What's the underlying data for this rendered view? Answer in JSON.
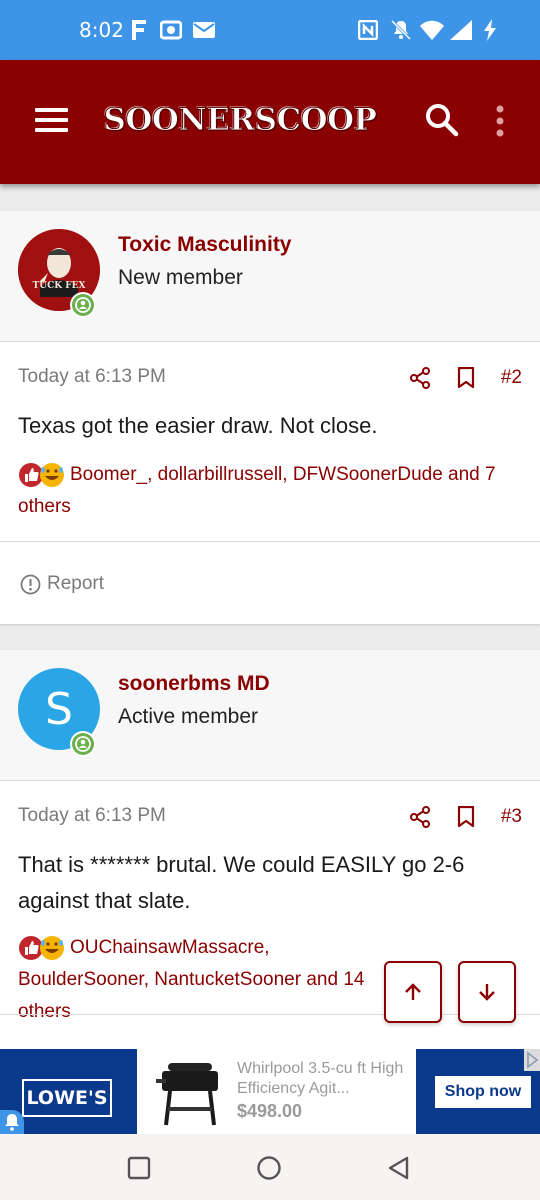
{
  "status_bar": {
    "time": "8:02",
    "icons": [
      "facebook-icon",
      "camera-icon",
      "mail-icon",
      "nfc-icon",
      "mute-icon",
      "wifi-icon",
      "signal-icon",
      "charging-icon"
    ]
  },
  "app_bar": {
    "logo_text": "SOONERSCOOP",
    "icons": [
      "menu-icon",
      "search-icon",
      "more-vert-icon"
    ]
  },
  "posts": [
    {
      "username": "Toxic Masculinity",
      "user_title": "New member",
      "avatar_text": "TUCK FEX",
      "time": "Today at 6:13 PM",
      "post_number": "#2",
      "body": "Texas got the easier draw. Not close.",
      "reactions": "Boomer_, dollarbillrussell, DFWSoonerDude and 7 others",
      "report_label": "Report"
    },
    {
      "username": "soonerbms MD",
      "user_title": "Active member",
      "avatar_letter": "S",
      "time": "Today at 6:13 PM",
      "post_number": "#3",
      "body": "That is ******* brutal. We could EASILY go 2-6 against that slate.",
      "reactions": "OUChainsawMassacre, BoulderSooner, NantucketSooner and 14 others"
    }
  ],
  "ad": {
    "brand": "LOWE'S",
    "product_title": "Whirlpool 3.5-cu ft High Efficiency Agit...",
    "price": "$498.00",
    "cta": "Shop now"
  },
  "colors": {
    "brand": "#8b0000",
    "status_bar": "#3e95e8",
    "online": "#6ab04c",
    "ad_blue": "#0b3a8c"
  }
}
